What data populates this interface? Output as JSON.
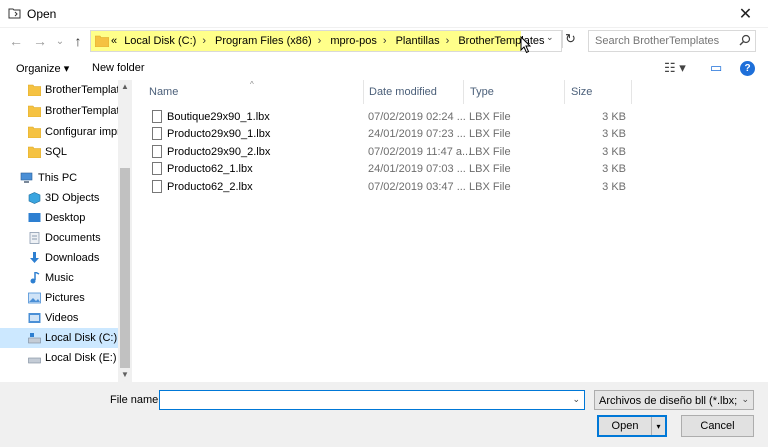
{
  "window": {
    "title": "Open",
    "close_glyph": "✕"
  },
  "nav": {
    "back_glyph": "←",
    "forward_glyph": "→",
    "recent_glyph": "⌄",
    "up_glyph": "↑",
    "breadcrumbs": [
      "«",
      "Local Disk (C:)",
      "Program Files (x86)",
      "mpro-pos",
      "Plantillas",
      "BrotherTemplates"
    ],
    "separator": "›",
    "dropdown_glyph": "⌄",
    "refresh_glyph": "↻"
  },
  "search": {
    "placeholder": "Search BrotherTemplates",
    "icon": "search-icon"
  },
  "toolbar": {
    "organize_label": "Organize ▾",
    "new_folder_label": "New folder",
    "view_glyph": "☷ ▾",
    "pane_glyph": "▭",
    "help_label": "?"
  },
  "sidebar": {
    "items": [
      {
        "label": "BrotherTemplate",
        "icon": "folder-icon",
        "color": "#f5c242"
      },
      {
        "label": "BrotherTemplate",
        "icon": "folder-icon",
        "color": "#f5c242"
      },
      {
        "label": "Configurar impr",
        "icon": "folder-icon",
        "color": "#f5c242"
      },
      {
        "label": "SQL",
        "icon": "folder-icon",
        "color": "#f5c242"
      },
      {
        "label": "This PC",
        "icon": "computer-icon",
        "color": "#4a8fd6"
      },
      {
        "label": "3D Objects",
        "icon": "cube-icon",
        "color": "#3aa5e0"
      },
      {
        "label": "Desktop",
        "icon": "desktop-icon",
        "color": "#2d7fd1"
      },
      {
        "label": "Documents",
        "icon": "document-icon",
        "color": "#8a9bb0"
      },
      {
        "label": "Downloads",
        "icon": "download-icon",
        "color": "#2d7fd1"
      },
      {
        "label": "Music",
        "icon": "music-icon",
        "color": "#2d7fd1"
      },
      {
        "label": "Pictures",
        "icon": "picture-icon",
        "color": "#4a8fd6"
      },
      {
        "label": "Videos",
        "icon": "video-icon",
        "color": "#4a8fd6"
      },
      {
        "label": "Local Disk (C:)",
        "icon": "drive-icon",
        "color": "#7a8899"
      },
      {
        "label": "Local Disk (E:)",
        "icon": "drive-icon",
        "color": "#7a8899"
      }
    ],
    "selected_index": 12,
    "scroll_up_glyph": "▲",
    "scroll_down_glyph": "▼"
  },
  "columns": {
    "name": "Name",
    "date": "Date modified",
    "type": "Type",
    "size": "Size",
    "sort_glyph": "^"
  },
  "files": [
    {
      "name": "Boutique29x90_1.lbx",
      "date": "07/02/2019 02:24 ...",
      "type": "LBX File",
      "size": "3 KB"
    },
    {
      "name": "Producto29x90_1.lbx",
      "date": "24/01/2019 07:23 ...",
      "type": "LBX File",
      "size": "3 KB"
    },
    {
      "name": "Producto29x90_2.lbx",
      "date": "07/02/2019 11:47 a...",
      "type": "LBX File",
      "size": "3 KB"
    },
    {
      "name": "Producto62_1.lbx",
      "date": "24/01/2019 07:03 ...",
      "type": "LBX File",
      "size": "3 KB"
    },
    {
      "name": "Producto62_2.lbx",
      "date": "07/02/2019 03:47 ...",
      "type": "LBX File",
      "size": "3 KB"
    }
  ],
  "footer": {
    "file_name_label": "File name:",
    "file_name_value": "",
    "dropdown_glyph": "⌄",
    "filter_value": "Archivos de diseño bll (*.lbx; *.l",
    "open_label": "Open",
    "open_split_glyph": "▾",
    "cancel_label": "Cancel"
  },
  "colors": {
    "accent": "#0078d7",
    "address_highlight": "#ffff8a",
    "selected": "#cce8ff"
  }
}
